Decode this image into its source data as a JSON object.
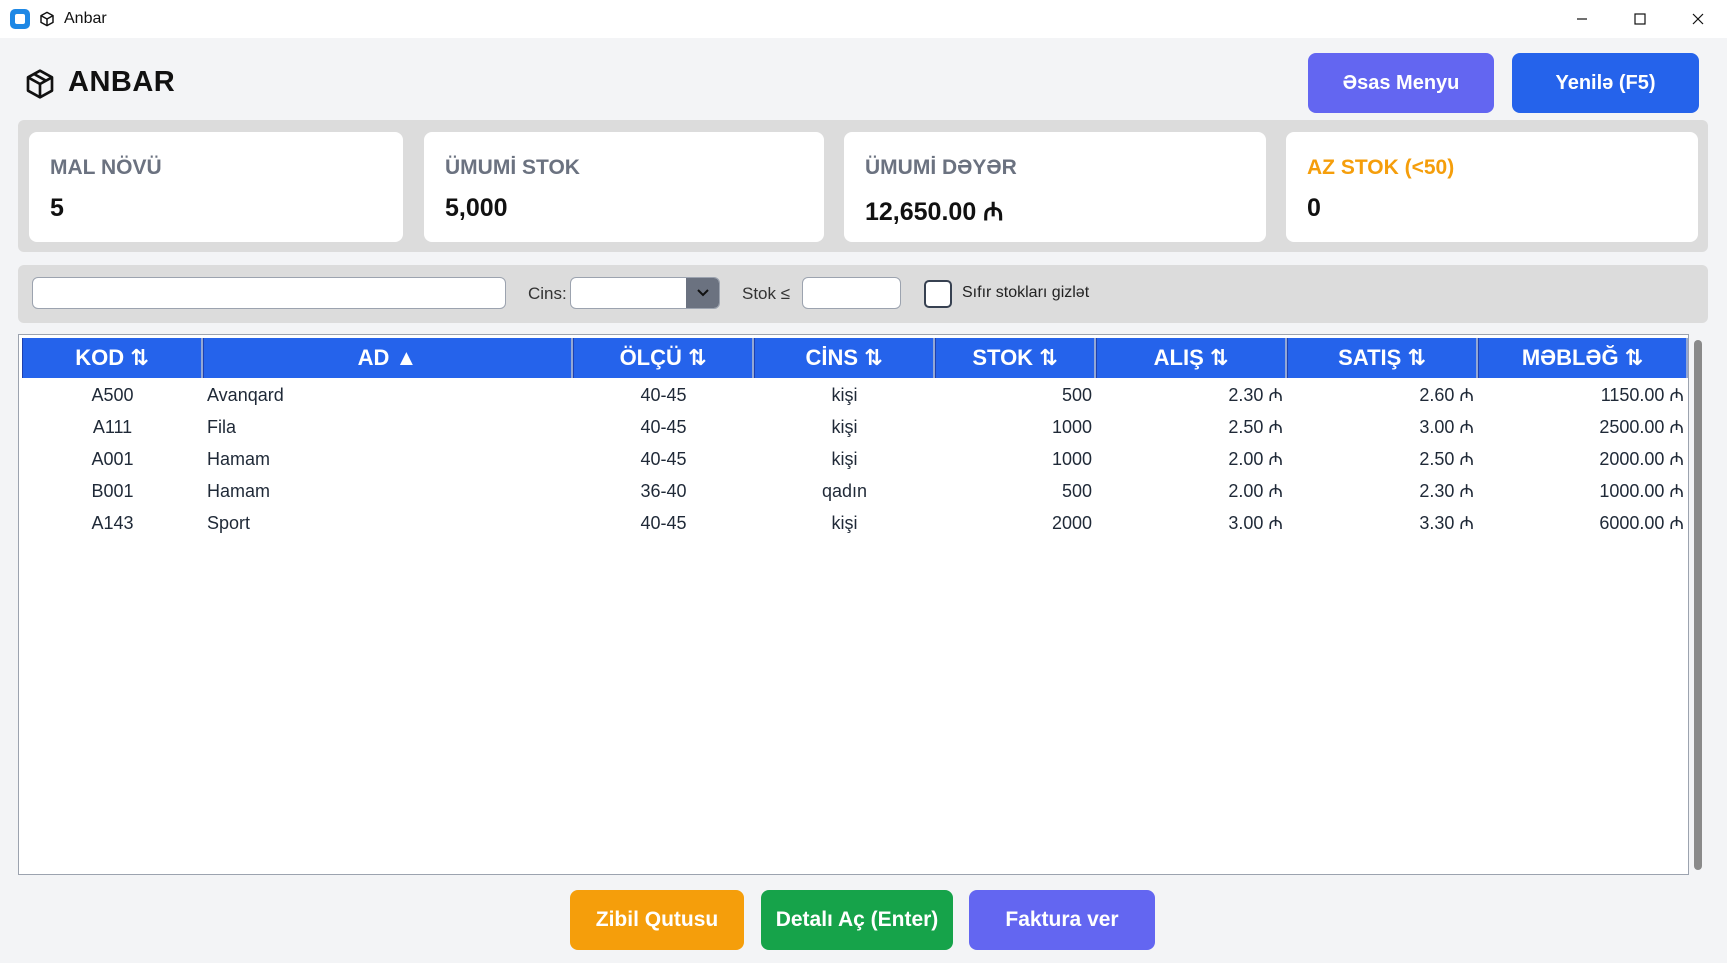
{
  "window": {
    "title": "Anbar",
    "controls": {
      "minimize": "—",
      "maximize": "☐",
      "close": "✕"
    }
  },
  "header": {
    "title": "ANBAR",
    "menu_button": "Əsas Menyu",
    "refresh_button": "Yenilə (F5)"
  },
  "stats": [
    {
      "label": "MAL NÖVÜ",
      "value": "5"
    },
    {
      "label": "ÜMUMİ STOK",
      "value": "5,000"
    },
    {
      "label": "ÜMUMİ DƏYƏR",
      "value": "12,650.00 ₼"
    },
    {
      "label": "AZ STOK (<50)",
      "value": "0"
    }
  ],
  "filters": {
    "search_value": "",
    "cins_label": "Cins:",
    "cins_value": "",
    "stok_label": "Stok ≤",
    "stok_value": "",
    "hide_zero_label": "Sıfır stokları gizlət",
    "hide_zero_checked": false
  },
  "table": {
    "headers": [
      "KOD ⇅",
      "AD ▲",
      "ÖLÇÜ ⇅",
      "CİNS ⇅",
      "STOK ⇅",
      "ALIŞ ⇅",
      "SATIŞ ⇅",
      "MƏBLƏĞ ⇅"
    ],
    "rows": [
      [
        "A500",
        "Avanqard",
        "40-45",
        "kişi",
        "500",
        "2.30 ₼",
        "2.60 ₼",
        "1150.00 ₼"
      ],
      [
        "A111",
        "Fila",
        "40-45",
        "kişi",
        "1000",
        "2.50 ₼",
        "3.00 ₼",
        "2500.00 ₼"
      ],
      [
        "A001",
        "Hamam",
        "40-45",
        "kişi",
        "1000",
        "2.00 ₼",
        "2.50 ₼",
        "2000.00 ₼"
      ],
      [
        "B001",
        "Hamam",
        "36-40",
        "qadın",
        "500",
        "2.00 ₼",
        "2.30 ₼",
        "1000.00 ₼"
      ],
      [
        "A143",
        "Sport",
        "40-45",
        "kişi",
        "2000",
        "3.00 ₼",
        "3.30 ₼",
        "6000.00 ₼"
      ]
    ]
  },
  "footer": {
    "trash_button": "Zibil Qutusu",
    "detail_button": "Detalı Aç (Enter)",
    "invoice_button": "Faktura ver"
  },
  "colors": {
    "primary": "#2563eb",
    "indigo": "#6366f1",
    "warning": "#f59e0b",
    "success": "#16a34a"
  }
}
